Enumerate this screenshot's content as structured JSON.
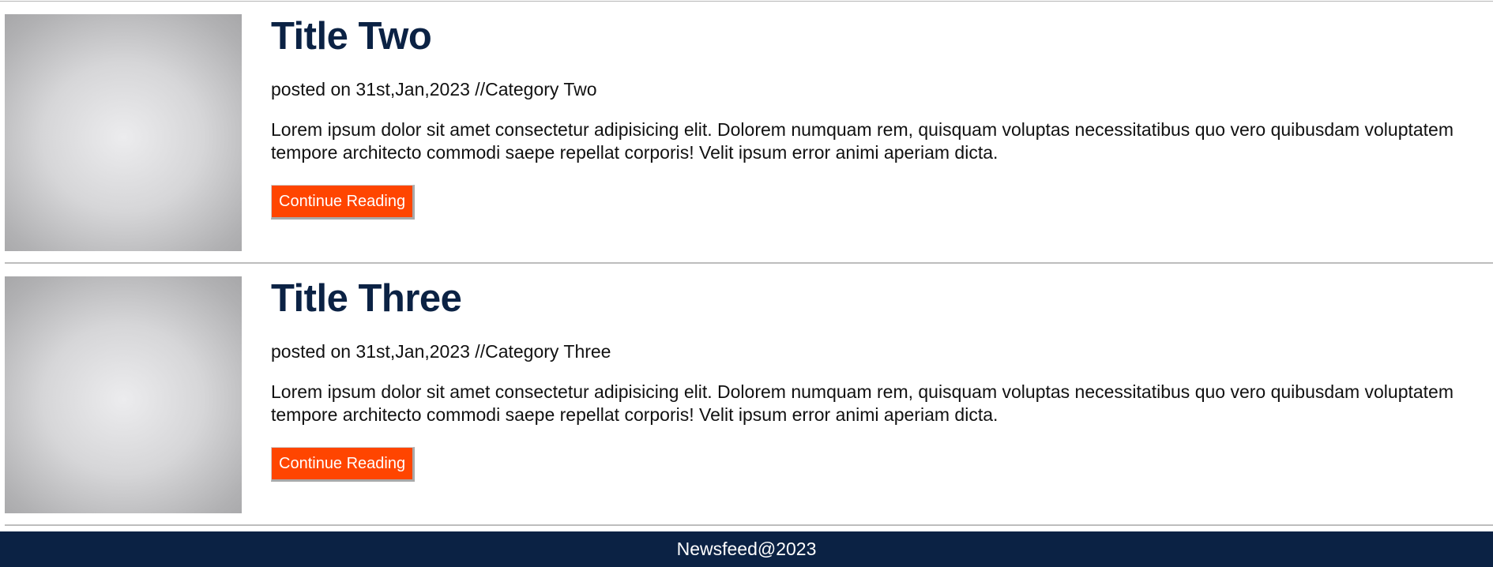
{
  "posts": [
    {
      "title": "Title Two",
      "meta": "posted on 31st,Jan,2023 //Category Two",
      "text": "Lorem ipsum dolor sit amet consectetur adipisicing elit. Dolorem numquam rem, quisquam voluptas necessitatibus quo vero quibusdam voluptatem tempore architecto commodi saepe repellat corporis! Velit ipsum error animi aperiam dicta.",
      "button_label": "Continue Reading"
    },
    {
      "title": "Title Three",
      "meta": "posted on 31st,Jan,2023 //Category Three",
      "text": "Lorem ipsum dolor sit amet consectetur adipisicing elit. Dolorem numquam rem, quisquam voluptas necessitatibus quo vero quibusdam voluptatem tempore architecto commodi saepe repellat corporis! Velit ipsum error animi aperiam dicta.",
      "button_label": "Continue Reading"
    }
  ],
  "footer": {
    "text": "Newsfeed@2023"
  },
  "colors": {
    "title": "#0b2244",
    "button": "#ff4500",
    "footer_bg": "#0b2244"
  }
}
